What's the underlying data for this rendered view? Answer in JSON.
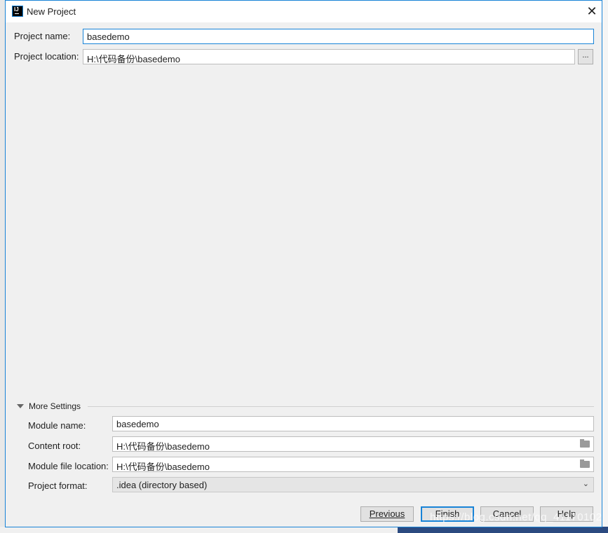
{
  "window": {
    "title": "New Project",
    "close_label": "✕",
    "app_icon_text": "IJ"
  },
  "project": {
    "name_label": "Project name:",
    "name_value": "basedemo",
    "location_label": "Project location:",
    "location_value": "H:\\代码备份\\basedemo",
    "browse_label": "..."
  },
  "more_settings": {
    "header": "More Settings",
    "module_name_label": "Module name:",
    "module_name_value": "basedemo",
    "content_root_label": "Content root:",
    "content_root_value": "H:\\代码备份\\basedemo",
    "module_file_label": "Module file location:",
    "module_file_value": "H:\\代码备份\\basedemo",
    "format_label": "Project format:",
    "format_value": ".idea (directory based)"
  },
  "buttons": {
    "previous": "Previous",
    "finish": "Finish",
    "cancel": "Cancel",
    "help": "Help"
  },
  "watermark": "https://blog.csdn.net/qq_41170102",
  "colors": {
    "accent": "#1883d7",
    "dialog_bg": "#f0f0f0"
  }
}
